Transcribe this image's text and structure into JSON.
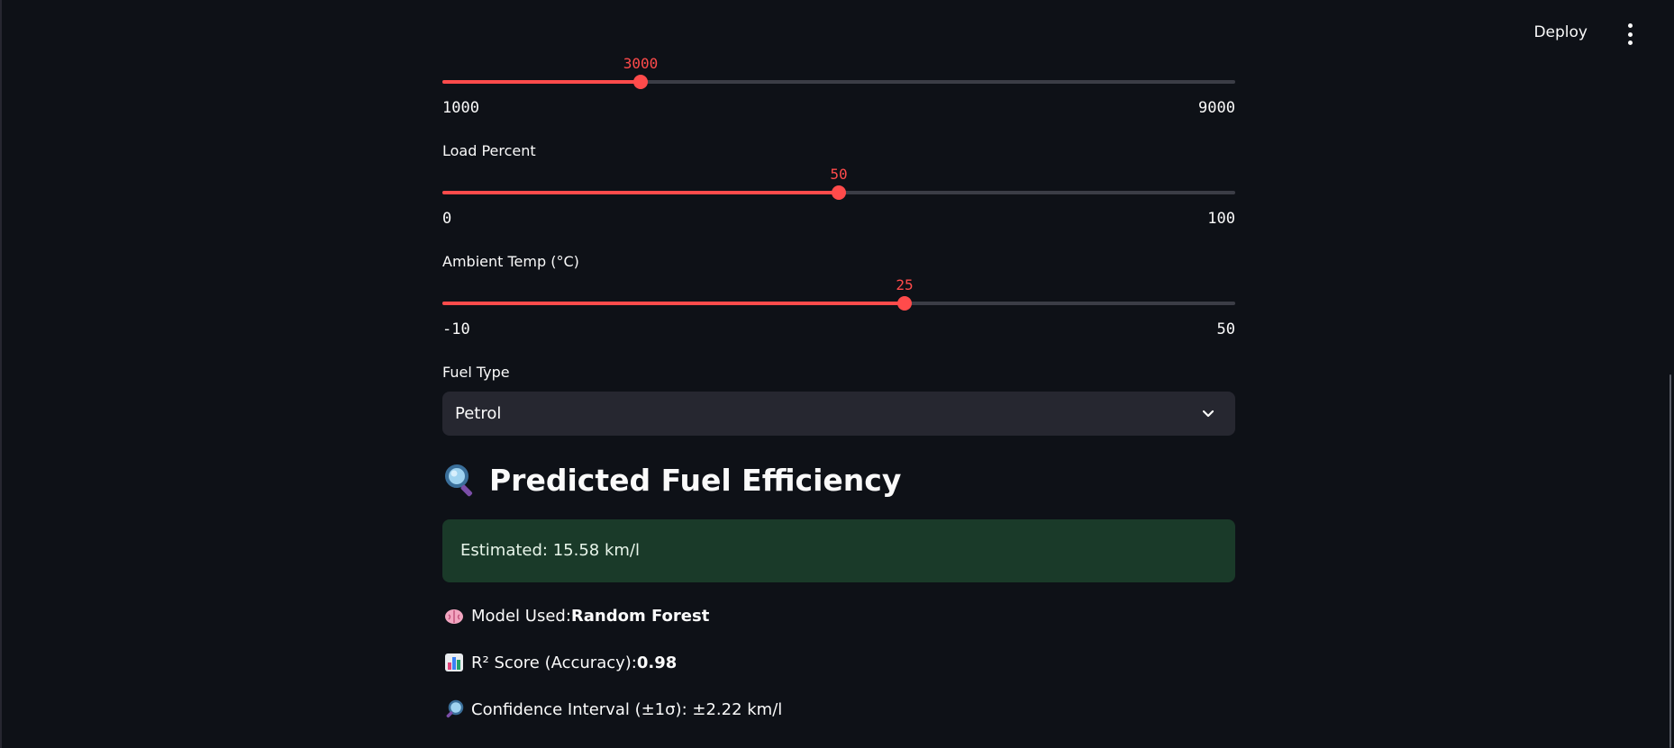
{
  "header": {
    "deploy_label": "Deploy",
    "menu_icon": "kebab-menu-icon"
  },
  "sliders": [
    {
      "label": "",
      "value": "3000",
      "min": "1000",
      "max": "9000",
      "fraction": 0.25
    },
    {
      "label": "Load Percent",
      "value": "50",
      "min": "0",
      "max": "100",
      "fraction": 0.5
    },
    {
      "label": "Ambient Temp (°C)",
      "value": "25",
      "min": "-10",
      "max": "50",
      "fraction": 0.5833
    }
  ],
  "fuel_type": {
    "label": "Fuel Type",
    "selected": "Petrol"
  },
  "prediction": {
    "title": "Predicted Fuel Efficiency",
    "estimate_text": "Estimated: 15.58 km/l",
    "model_prefix": "Model Used: ",
    "model_value": "Random Forest",
    "r2_prefix": "R² Score (Accuracy): ",
    "r2_value": "0.98",
    "confidence_text": "Confidence Interval (±1σ): ±2.22 km/l"
  },
  "colors": {
    "accent": "#ff4b4b",
    "background": "#0e1117",
    "success_bg": "#1a3a29"
  }
}
